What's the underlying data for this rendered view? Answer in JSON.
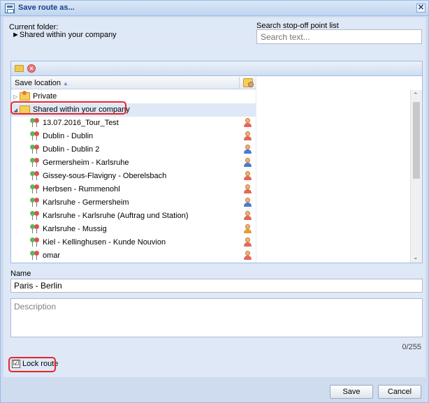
{
  "window": {
    "title": "Save route as...",
    "close_glyph": "✕"
  },
  "folder": {
    "current_label": "Current folder:",
    "current_value": "►Shared within your company"
  },
  "search": {
    "label": "Search stop-off point list",
    "placeholder": "Search text..."
  },
  "toolbar": {
    "new_folder_icon": "folder-add-icon",
    "delete_icon": "delete-icon"
  },
  "grid": {
    "column_header": "Save location",
    "sort_glyph": "▲",
    "folders": [
      {
        "label": "Private",
        "expander": "▷"
      },
      {
        "label": "Shared within your company",
        "expander": "◢"
      }
    ],
    "routes": [
      {
        "label": "13.07.2016_Tour_Test",
        "user_color": "#e06a5a"
      },
      {
        "label": "Dublin - Dublin",
        "user_color": "#e06a5a"
      },
      {
        "label": "Dublin - Dublin 2",
        "user_color": "#4a7bd0"
      },
      {
        "label": "Germersheim - Karlsruhe",
        "user_color": "#4a7bd0"
      },
      {
        "label": "Gissey-sous-Flavigny - Oberelsbach",
        "user_color": "#e06a5a"
      },
      {
        "label": "Herbsen - Rummenohl",
        "user_color": "#e06a5a"
      },
      {
        "label": "Karlsruhe - Germersheim",
        "user_color": "#4a7bd0"
      },
      {
        "label": "Karlsruhe - Karlsruhe (Auftrag und Station)",
        "user_color": "#e06a5a"
      },
      {
        "label": "Karlsruhe - Mussig",
        "user_color": "#e0a030"
      },
      {
        "label": "Kiel - Kellinghusen - Kunde Nouvion",
        "user_color": "#e06a5a"
      },
      {
        "label": "omar",
        "user_color": "#e06a5a"
      }
    ]
  },
  "form": {
    "name_label": "Name",
    "name_value": "Paris - Berlin",
    "description_placeholder": "Description",
    "counter": "0/255",
    "lock_label": "Lock route",
    "lock_checked": "☑"
  },
  "buttons": {
    "save": "Save",
    "cancel": "Cancel"
  },
  "colors": {
    "accent": "#15428b",
    "highlight": "#e8252b",
    "selected_row": "#dfe8f6"
  }
}
